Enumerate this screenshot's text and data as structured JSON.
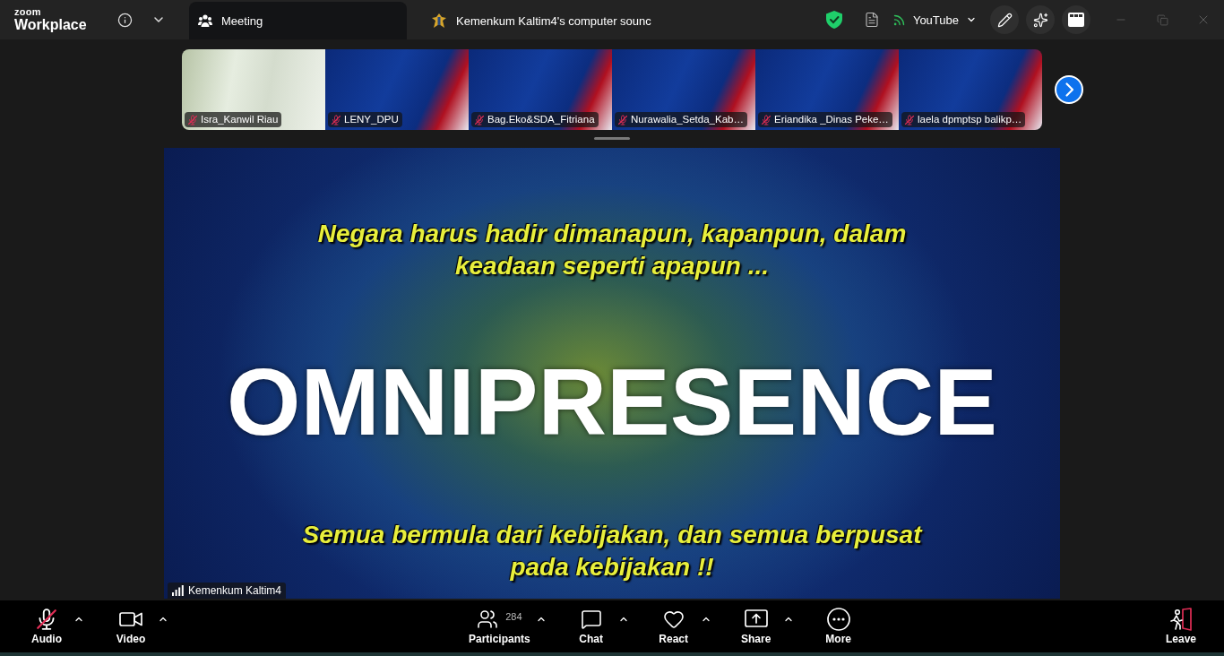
{
  "app": {
    "logo_small": "zoom",
    "logo_large": "Workplace"
  },
  "tabs": [
    {
      "kind": "meeting",
      "label": "Meeting",
      "selected": true
    },
    {
      "kind": "share",
      "label": "Kemenkum Kaltim4's computer sounc",
      "selected": false
    }
  ],
  "livestream": {
    "label": "YouTube"
  },
  "gallery": [
    {
      "kind": "camera",
      "name": "Isra_Kanwil Riau",
      "muted": true
    },
    {
      "kind": "screen",
      "name": "LENY_DPU",
      "muted": true
    },
    {
      "kind": "screen",
      "name": "Bag.Eko&SDA_Fitriana",
      "muted": true
    },
    {
      "kind": "screen",
      "name": "Nurawalia_Setda_Kab…",
      "muted": true
    },
    {
      "kind": "screen",
      "name": "Eriandika _Dinas Peke…",
      "muted": true
    },
    {
      "kind": "screen",
      "name": "laela dpmptsp balikp…",
      "muted": true
    }
  ],
  "shared_screen": {
    "top_text": [
      "Negara harus hadir dimanapun, kapanpun, dalam",
      "keadaan seperti apapun ..."
    ],
    "title": "OMNIPRESENCE",
    "bottom_text": [
      "Semua bermula dari kebijakan, dan semua berpusat",
      "pada kebijakan !!"
    ],
    "presenter": "Kemenkum Kaltim4"
  },
  "controls": {
    "left": [
      {
        "kind": "audio",
        "label": "Audio",
        "muted": true,
        "menu": true
      },
      {
        "kind": "video",
        "label": "Video",
        "muted": false,
        "menu": true
      }
    ],
    "center": [
      {
        "kind": "participants",
        "label": "Participants",
        "count": "284",
        "menu": true
      },
      {
        "kind": "chat",
        "label": "Chat",
        "menu": true
      },
      {
        "kind": "react",
        "label": "React",
        "menu": true
      },
      {
        "kind": "share",
        "label": "Share",
        "menu": true
      },
      {
        "kind": "more",
        "label": "More",
        "menu": false
      }
    ],
    "right": [
      {
        "kind": "leave",
        "label": "Leave",
        "menu": false
      }
    ]
  }
}
